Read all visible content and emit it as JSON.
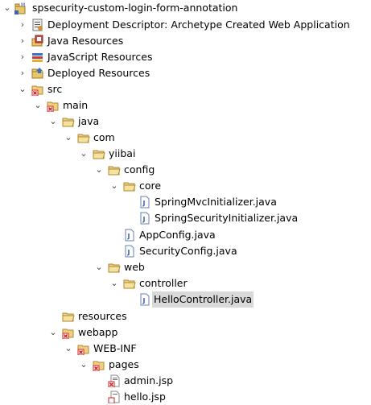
{
  "tree": {
    "rows": [
      {
        "label": "spsecurity-custom-login-form-annotation",
        "expanded": true,
        "icon": "project-icon"
      },
      {
        "label": "Deployment Descriptor: Archetype Created Web Application",
        "expanded": false,
        "icon": "deployment-descriptor-icon"
      },
      {
        "label": "Java Resources",
        "expanded": false,
        "icon": "java-resources-icon"
      },
      {
        "label": "JavaScript Resources",
        "expanded": false,
        "icon": "javascript-resources-icon"
      },
      {
        "label": "Deployed Resources",
        "expanded": false,
        "icon": "deployed-resources-icon"
      },
      {
        "label": "src",
        "expanded": true,
        "icon": "folder-error-icon"
      },
      {
        "label": "main",
        "expanded": true,
        "icon": "folder-error-icon"
      },
      {
        "label": "java",
        "expanded": true,
        "icon": "folder-icon"
      },
      {
        "label": "com",
        "expanded": true,
        "icon": "folder-icon"
      },
      {
        "label": "yiibai",
        "expanded": true,
        "icon": "folder-icon"
      },
      {
        "label": "config",
        "expanded": true,
        "icon": "folder-icon"
      },
      {
        "label": "core",
        "expanded": true,
        "icon": "folder-icon"
      },
      {
        "label": "SpringMvcInitializer.java",
        "icon": "java-file-icon"
      },
      {
        "label": "SpringSecurityInitializer.java",
        "icon": "java-file-icon"
      },
      {
        "label": "AppConfig.java",
        "icon": "java-file-icon"
      },
      {
        "label": "SecurityConfig.java",
        "icon": "java-file-icon"
      },
      {
        "label": "web",
        "expanded": true,
        "icon": "folder-icon"
      },
      {
        "label": "controller",
        "expanded": true,
        "icon": "folder-icon"
      },
      {
        "label": "HelloController.java",
        "icon": "java-file-icon",
        "selected": true
      },
      {
        "label": "resources",
        "icon": "folder-icon"
      },
      {
        "label": "webapp",
        "expanded": true,
        "icon": "folder-error-icon"
      },
      {
        "label": "WEB-INF",
        "expanded": true,
        "icon": "folder-error-icon"
      },
      {
        "label": "pages",
        "expanded": true,
        "icon": "folder-error-icon"
      },
      {
        "label": "admin.jsp",
        "icon": "jsp-file-error-icon"
      },
      {
        "label": "hello.jsp",
        "icon": "jsp-file-error-icon"
      }
    ]
  }
}
